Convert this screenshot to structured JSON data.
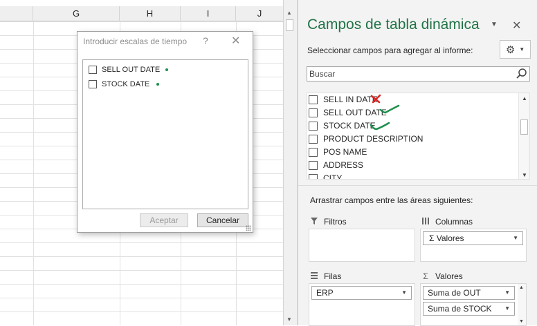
{
  "sheet": {
    "columns": [
      {
        "label": "G"
      },
      {
        "label": "H"
      },
      {
        "label": "I"
      },
      {
        "label": "J"
      }
    ]
  },
  "dialog": {
    "title": "Introducir escalas de tiempo",
    "help": "?",
    "close": "✕",
    "items": [
      "SELL OUT DATE",
      "STOCK DATE"
    ],
    "ok_label": "Aceptar",
    "cancel_label": "Cancelar"
  },
  "pane": {
    "title": "Campos de tabla dinámica",
    "choose_label": "Seleccionar campos para agregar al informe:",
    "search_placeholder": "Buscar",
    "fields": [
      "SELL IN DATE",
      "SELL OUT DATE",
      "STOCK DATE",
      "PRODUCT DESCRIPTION",
      "POS NAME",
      "ADDRESS",
      "CITY"
    ],
    "areas_label": "Arrastrar campos entre las áreas siguientes:",
    "areas": {
      "filters": {
        "label": "Filtros",
        "items": []
      },
      "columns": {
        "label": "Columnas",
        "items": [
          "Σ  Valores"
        ]
      },
      "rows": {
        "label": "Filas",
        "items": [
          "ERP"
        ]
      },
      "values": {
        "label": "Valores",
        "items": [
          "Suma de OUT",
          "Suma de STOCK"
        ]
      }
    },
    "colors": {
      "title": "#217346",
      "annotation_red": "#e02424",
      "annotation_green": "#1f8f4e"
    }
  }
}
